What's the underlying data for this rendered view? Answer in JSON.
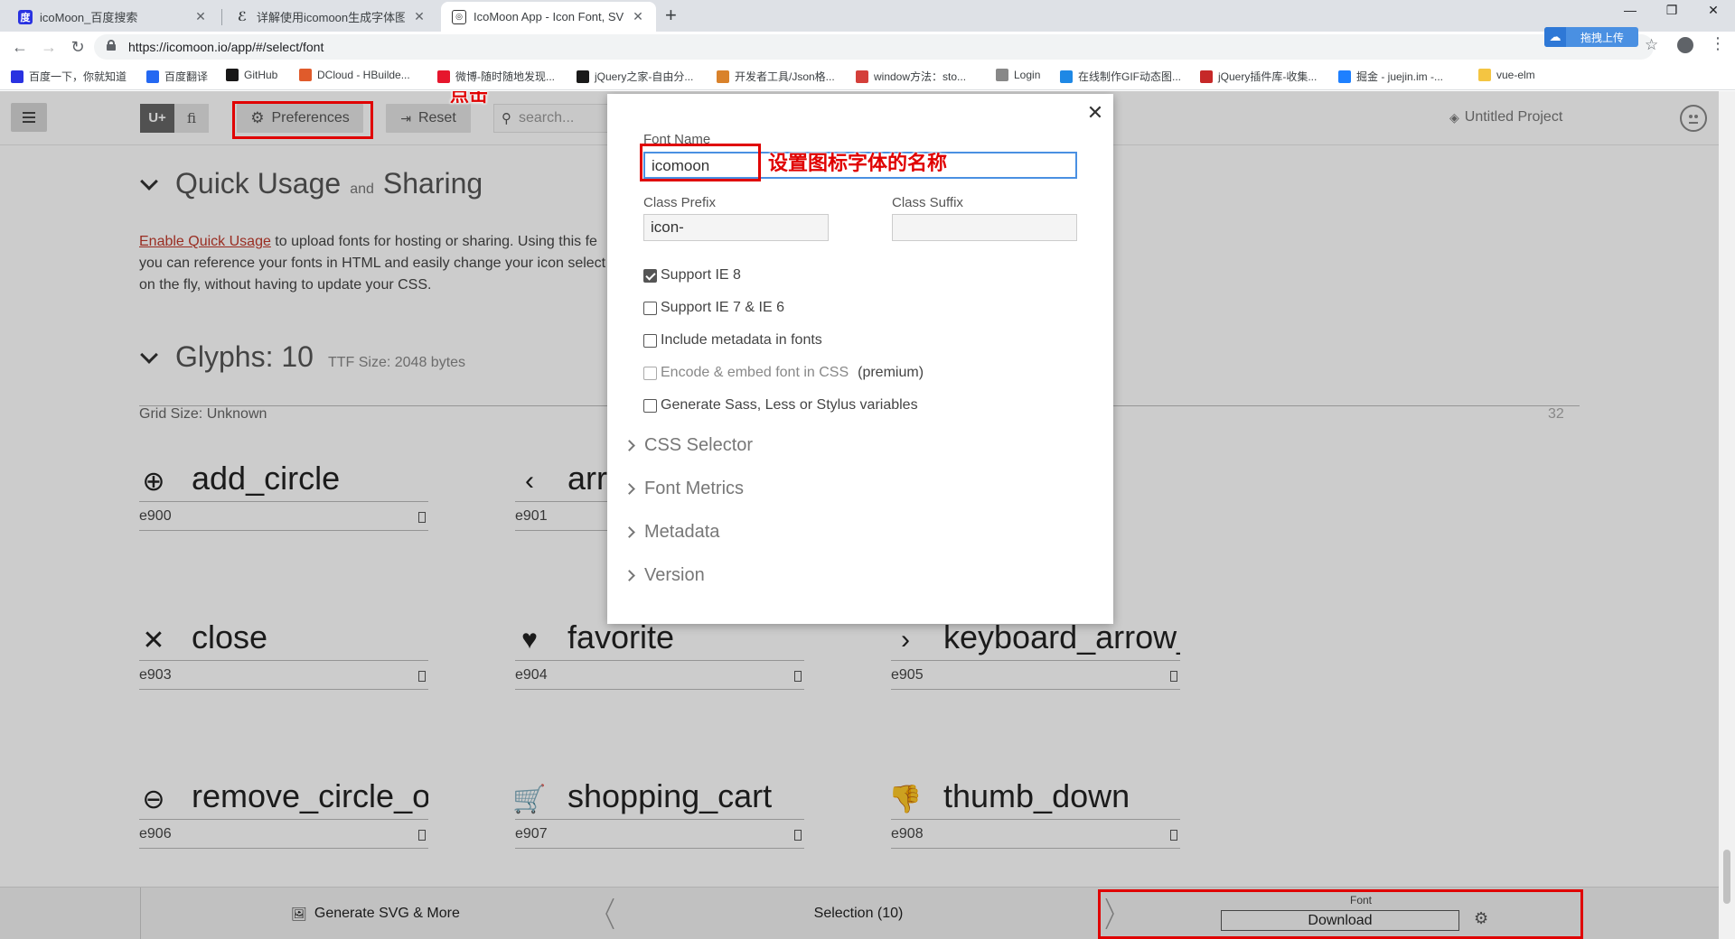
{
  "browser": {
    "tabs": [
      {
        "label": "icoMoon_百度搜索",
        "active": false
      },
      {
        "label": "详解使用icomoon生成字体图标...",
        "active": false
      },
      {
        "label": "IcoMoon App - Icon Font, SVG",
        "active": true
      }
    ],
    "url": "https://icomoon.io/app/#/select/font",
    "upload_button": "拖拽上传",
    "bookmarks": [
      {
        "label": "百度一下，你就知道",
        "icon": "baidu-icon",
        "color": "#2932e1"
      },
      {
        "label": "百度翻译",
        "icon": "translate-icon",
        "color": "#2468f2"
      },
      {
        "label": "GitHub",
        "icon": "github-icon",
        "color": "#181717"
      },
      {
        "label": "DCloud - HBuilde...",
        "icon": "dcloud-icon",
        "color": "#e05b2b"
      },
      {
        "label": "微博-随时随地发现...",
        "icon": "weibo-icon",
        "color": "#e6162d"
      },
      {
        "label": "jQuery之家-自由分...",
        "icon": "jquery-icon",
        "color": "#1a1a1a"
      },
      {
        "label": "开发者工具/Json格...",
        "icon": "tools-icon",
        "color": "#d9822b"
      },
      {
        "label": "window方法：sto...",
        "icon": "owl-icon",
        "color": "#d43f3a"
      },
      {
        "label": "Login",
        "icon": "page-icon",
        "color": "#888888"
      },
      {
        "label": "在线制作GIF动态图...",
        "icon": "gif-icon",
        "color": "#1e88e5"
      },
      {
        "label": "jQuery插件库-收集...",
        "icon": "jq-plugin-icon",
        "color": "#c62828"
      },
      {
        "label": "掘金 - juejin.im -...",
        "icon": "juejin-icon",
        "color": "#1e80ff"
      },
      {
        "label": "vue-elm",
        "icon": "folder-icon",
        "color": "#f4c542"
      }
    ]
  },
  "app": {
    "topbar": {
      "unicode_btn": "U+",
      "ligature_btn": "fi",
      "preferences_label": "Preferences",
      "reset_label": "Reset",
      "search_placeholder": "search...",
      "project_name": "Untitled Project"
    },
    "quick_usage": {
      "title": "Quick Usage",
      "and": "and",
      "title2": "Sharing",
      "link": "Enable Quick Usage",
      "line1": " to upload fonts for hosting or sharing. Using this fe",
      "line2": "you can reference your fonts in HTML and easily change your icon select",
      "line3": "on the fly, without having to update your CSS."
    },
    "glyphs_section": {
      "title": "Glyphs: 10",
      "meta": "TTF Size: 2048 bytes",
      "grid_label": "Grid Size: Unknown",
      "grid_value": "32"
    },
    "glyphs": [
      {
        "name": "add_circle",
        "code": "e900",
        "icon": "add-circle-icon",
        "glyph": "⊕"
      },
      {
        "name": "arr",
        "code": "e901",
        "icon": "arrow-back-icon",
        "glyph": "‹"
      },
      {
        "name": "",
        "code": "",
        "icon": "hidden-icon",
        "glyph": ""
      },
      {
        "name": "close",
        "code": "e903",
        "icon": "close-icon",
        "glyph": "✕"
      },
      {
        "name": "favorite",
        "code": "e904",
        "icon": "heart-icon",
        "glyph": "♥"
      },
      {
        "name": "keyboard_arrow_",
        "code": "e905",
        "icon": "chevron-right-icon",
        "glyph": "›"
      },
      {
        "name": "remove_circle_ou",
        "code": "e906",
        "icon": "remove-circle-icon",
        "glyph": "⊖"
      },
      {
        "name": "shopping_cart",
        "code": "e907",
        "icon": "cart-icon",
        "glyph": "🛒"
      },
      {
        "name": "thumb_down",
        "code": "e908",
        "icon": "thumb-down-icon",
        "glyph": "👎"
      }
    ],
    "bottom": {
      "generate": "Generate SVG & More",
      "selection": "Selection (10)",
      "font_caption": "Font",
      "download": "Download"
    }
  },
  "modal": {
    "font_name_label": "Font Name",
    "font_name_value": "icomoon",
    "class_prefix_label": "Class Prefix",
    "class_prefix_value": "icon-",
    "class_suffix_label": "Class Suffix",
    "class_suffix_value": "",
    "options": [
      {
        "label": "Support IE 8",
        "checked": true
      },
      {
        "label": "Support IE 7 & IE 6",
        "checked": false
      },
      {
        "label": "Include metadata in fonts",
        "checked": false
      },
      {
        "label": "Encode & embed font in CSS",
        "checked": false,
        "extra": "(premium)"
      },
      {
        "label": "Generate Sass, Less or Stylus variables",
        "checked": false
      }
    ],
    "sections": [
      "CSS Selector",
      "Font Metrics",
      "Metadata",
      "Version"
    ]
  },
  "annotations": {
    "click_hint": "点击",
    "font_name_hint": "设置图标字体的名称",
    "color": "#e00000"
  }
}
